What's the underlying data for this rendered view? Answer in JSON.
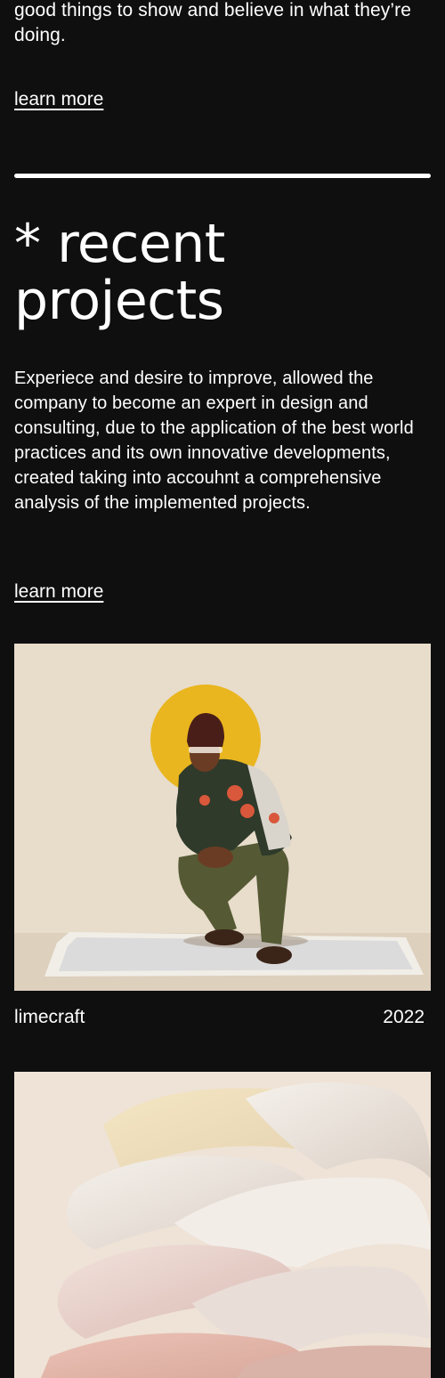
{
  "intro": {
    "text": "good things to show and believe in what they’re doing.",
    "learn_more": "learn more"
  },
  "projects_section": {
    "title": "* recent projects",
    "description": "Experiece and desire to improve, allowed the company to become an expert in design and consulting, due to the application of the best world practices and its own innovative developments, created taking into accouhnt a comprehensive analysis of the implemented projects.",
    "learn_more": "learn more"
  },
  "projects": [
    {
      "name": "limecraft",
      "year": "2022"
    }
  ],
  "colors": {
    "background": "#0f0f0f",
    "text": "#ffffff",
    "accent_circle": "#e9b61f",
    "image_bg_1": "#e8dccb",
    "image_bg_2": "#eee3d6"
  }
}
